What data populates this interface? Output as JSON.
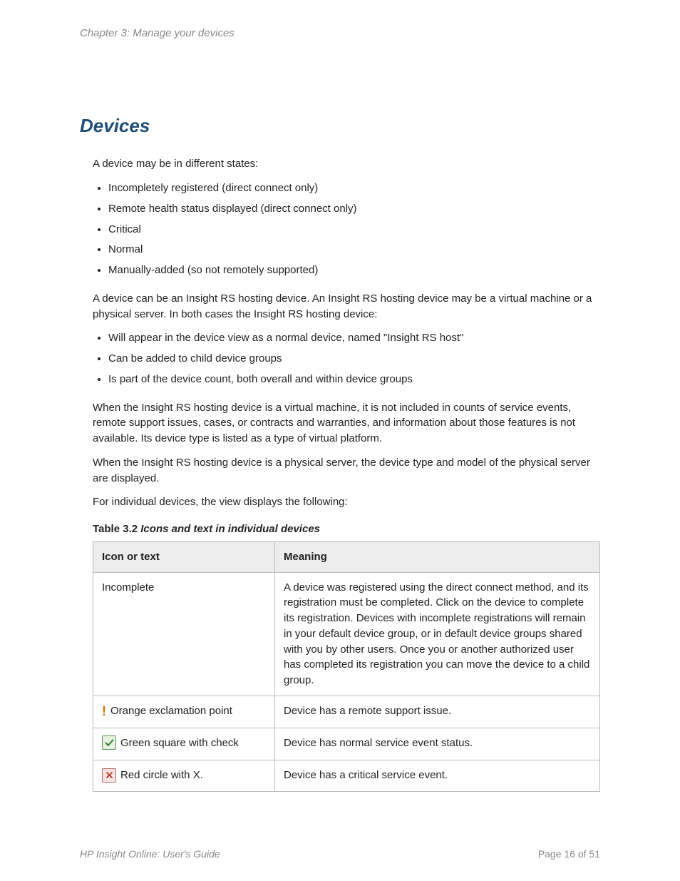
{
  "chapter": "Chapter 3: Manage your devices",
  "heading": "Devices",
  "intro": "A device may be in different states:",
  "states": [
    "Incompletely registered (direct connect only)",
    "Remote health status displayed (direct connect only)",
    "Critical",
    "Normal",
    "Manually-added (so not remotely supported)"
  ],
  "hosting_intro": "A device can be an Insight RS hosting device. An Insight RS hosting device may be a virtual machine or a physical server. In both cases the Insight RS hosting device:",
  "hosting_bullets": [
    "Will appear in the device view as a normal device, named \"Insight RS host\"",
    "Can be added to child device groups",
    "Is part of the device count, both overall and within device groups"
  ],
  "para_vm": "When the Insight RS hosting device is a virtual machine, it is not included in counts of service events, remote support issues, cases, or contracts and warranties, and information about those features is not available. Its device type is listed as a type of virtual platform.",
  "para_phys": "When the Insight RS hosting device is a physical server, the device type and model of the physical server are displayed.",
  "para_indiv": "For individual devices, the view displays the following:",
  "table_caption_lead": "Table 3.2 ",
  "table_caption_title": "Icons and text in individual devices",
  "table": {
    "header": {
      "col1": "Icon or text",
      "col2": "Meaning"
    },
    "rows": [
      {
        "icon": "none",
        "label": "Incomplete",
        "meaning": "A device was registered using the direct connect method, and its registration must be completed. Click on the device to complete its registration. Devices with incomplete registrations will remain in your default device group, or in default device groups shared with you by other users. Once you or another authorized user has completed its registration you can move the device to a child group."
      },
      {
        "icon": "exclaim",
        "label": "Orange exclamation point",
        "meaning": "Device has a remote support issue."
      },
      {
        "icon": "green-check",
        "label": "Green square with check",
        "meaning": "Device has normal service event status."
      },
      {
        "icon": "red-x",
        "label": "Red circle with X.",
        "meaning": "Device has a critical service event."
      }
    ]
  },
  "footer": {
    "guide": "HP Insight Online: User's Guide",
    "page": "Page 16 of 51"
  }
}
